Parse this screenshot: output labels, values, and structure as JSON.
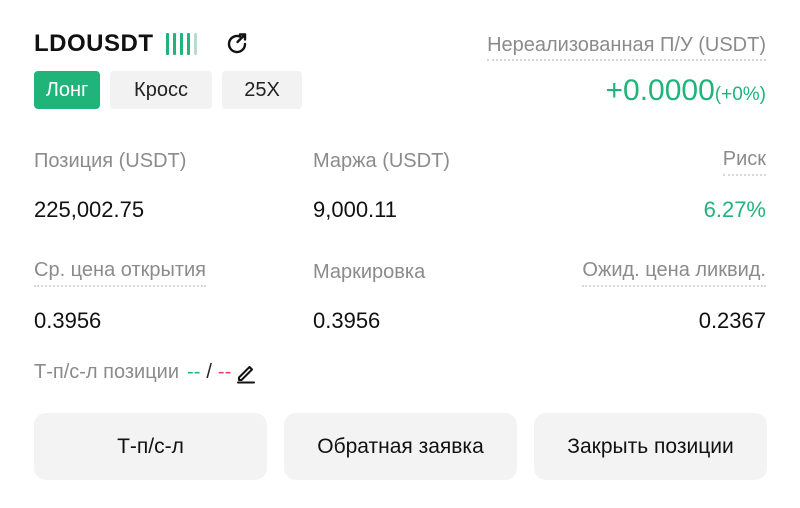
{
  "header": {
    "symbol": "LDOUSDT",
    "signal_icon": "signal-bars-icon",
    "share_icon": "share-icon"
  },
  "tags": {
    "side": "Лонг",
    "margin_mode": "Кросс",
    "leverage": "25X"
  },
  "pnl": {
    "label": "Нереализованная П/У (USDT)",
    "value": "+0.0000",
    "percent": "(+0%)"
  },
  "stats": {
    "position_label": "Позиция (USDT)",
    "position_value": "225,002.75",
    "margin_label": "Маржа (USDT)",
    "margin_value": "9,000.11",
    "risk_label": "Риск",
    "risk_value": "6.27%",
    "entry_label": "Ср. цена открытия",
    "entry_value": "0.3956",
    "mark_label": "Маркировка",
    "mark_value": "0.3956",
    "liq_label": "Ожид. цена ликвид.",
    "liq_value": "0.2367"
  },
  "tpsl": {
    "label": "Т-п/с-л позиции",
    "tp": "--",
    "separator": "/",
    "sl": "--",
    "edit_icon": "pencil-icon"
  },
  "buttons": {
    "tpsl": "Т-п/с-л",
    "reverse": "Обратная заявка",
    "close": "Закрыть позиции"
  },
  "colors": {
    "accent_green": "#21b47a",
    "loss_red": "#e0455c",
    "muted_text": "#8b8b8b"
  }
}
